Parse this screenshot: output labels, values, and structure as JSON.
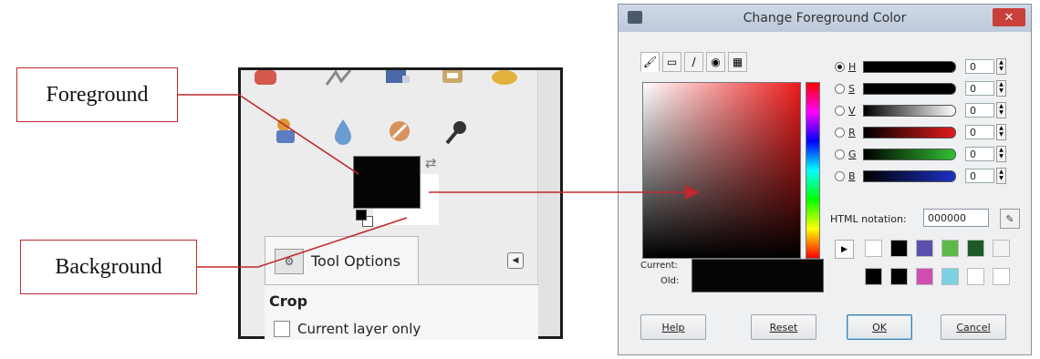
{
  "callouts": {
    "foreground": "Foreground",
    "background": "Background"
  },
  "toolbox": {
    "tool_options_tab": "Tool Options",
    "crop_label": "Crop",
    "current_layer_only": "Current layer only",
    "foreground_color": "#050505",
    "background_color": "#ffffff"
  },
  "dialog": {
    "title": "Change Foreground Color",
    "close_glyph": "✕",
    "channels": [
      {
        "letter": "H",
        "value": "0",
        "selected": true
      },
      {
        "letter": "S",
        "value": "0",
        "selected": false
      },
      {
        "letter": "V",
        "value": "0",
        "selected": false
      },
      {
        "letter": "R",
        "value": "0",
        "selected": false
      },
      {
        "letter": "G",
        "value": "0",
        "selected": false
      },
      {
        "letter": "B",
        "value": "0",
        "selected": false
      }
    ],
    "html_notation_label": "HTML notation:",
    "html_notation_value": "000000",
    "current_label": "Current:",
    "old_label": "Old:",
    "current_color": "#050505",
    "history_colors": [
      "#ffffff",
      "#000000",
      "#5b4fae",
      "#5cb948",
      "#1d5a26",
      "#f2f2f2",
      "#000000",
      "#000000",
      "#cf4fb0",
      "#7cd2e0",
      "#ffffff",
      "#ffffff"
    ],
    "buttons": {
      "help": "Help",
      "reset": "Reset",
      "ok": "OK",
      "cancel": "Cancel"
    }
  }
}
